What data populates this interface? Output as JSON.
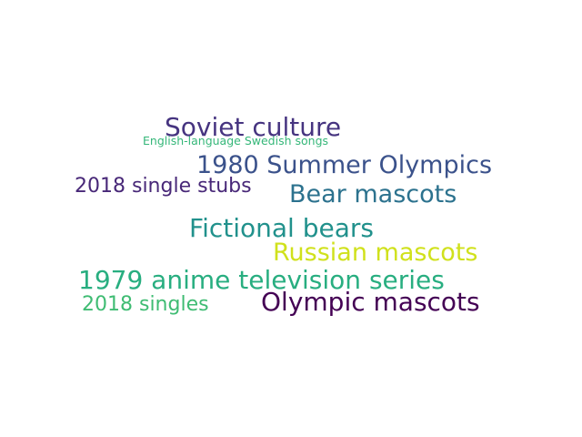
{
  "words": {
    "soviet_culture": {
      "text": "Soviet culture",
      "color": "#463480"
    },
    "english_swedish_songs": {
      "text": "English-language Swedish songs",
      "color": "#35b779"
    },
    "summer_olympics_1980": {
      "text": "1980 Summer Olympics",
      "color": "#3b528b"
    },
    "single_stubs_2018": {
      "text": "2018 single stubs",
      "color": "#482878"
    },
    "bear_mascots": {
      "text": "Bear mascots",
      "color": "#2c728e"
    },
    "fictional_bears": {
      "text": "Fictional bears",
      "color": "#21918c"
    },
    "russian_mascots": {
      "text": "Russian mascots",
      "color": "#d0e11c"
    },
    "anime_series_1979": {
      "text": "1979 anime television series",
      "color": "#28ae80"
    },
    "olympic_mascots": {
      "text": "Olympic mascots",
      "color": "#440154"
    },
    "singles_2018": {
      "text": "2018 singles",
      "color": "#3fbc73"
    }
  }
}
